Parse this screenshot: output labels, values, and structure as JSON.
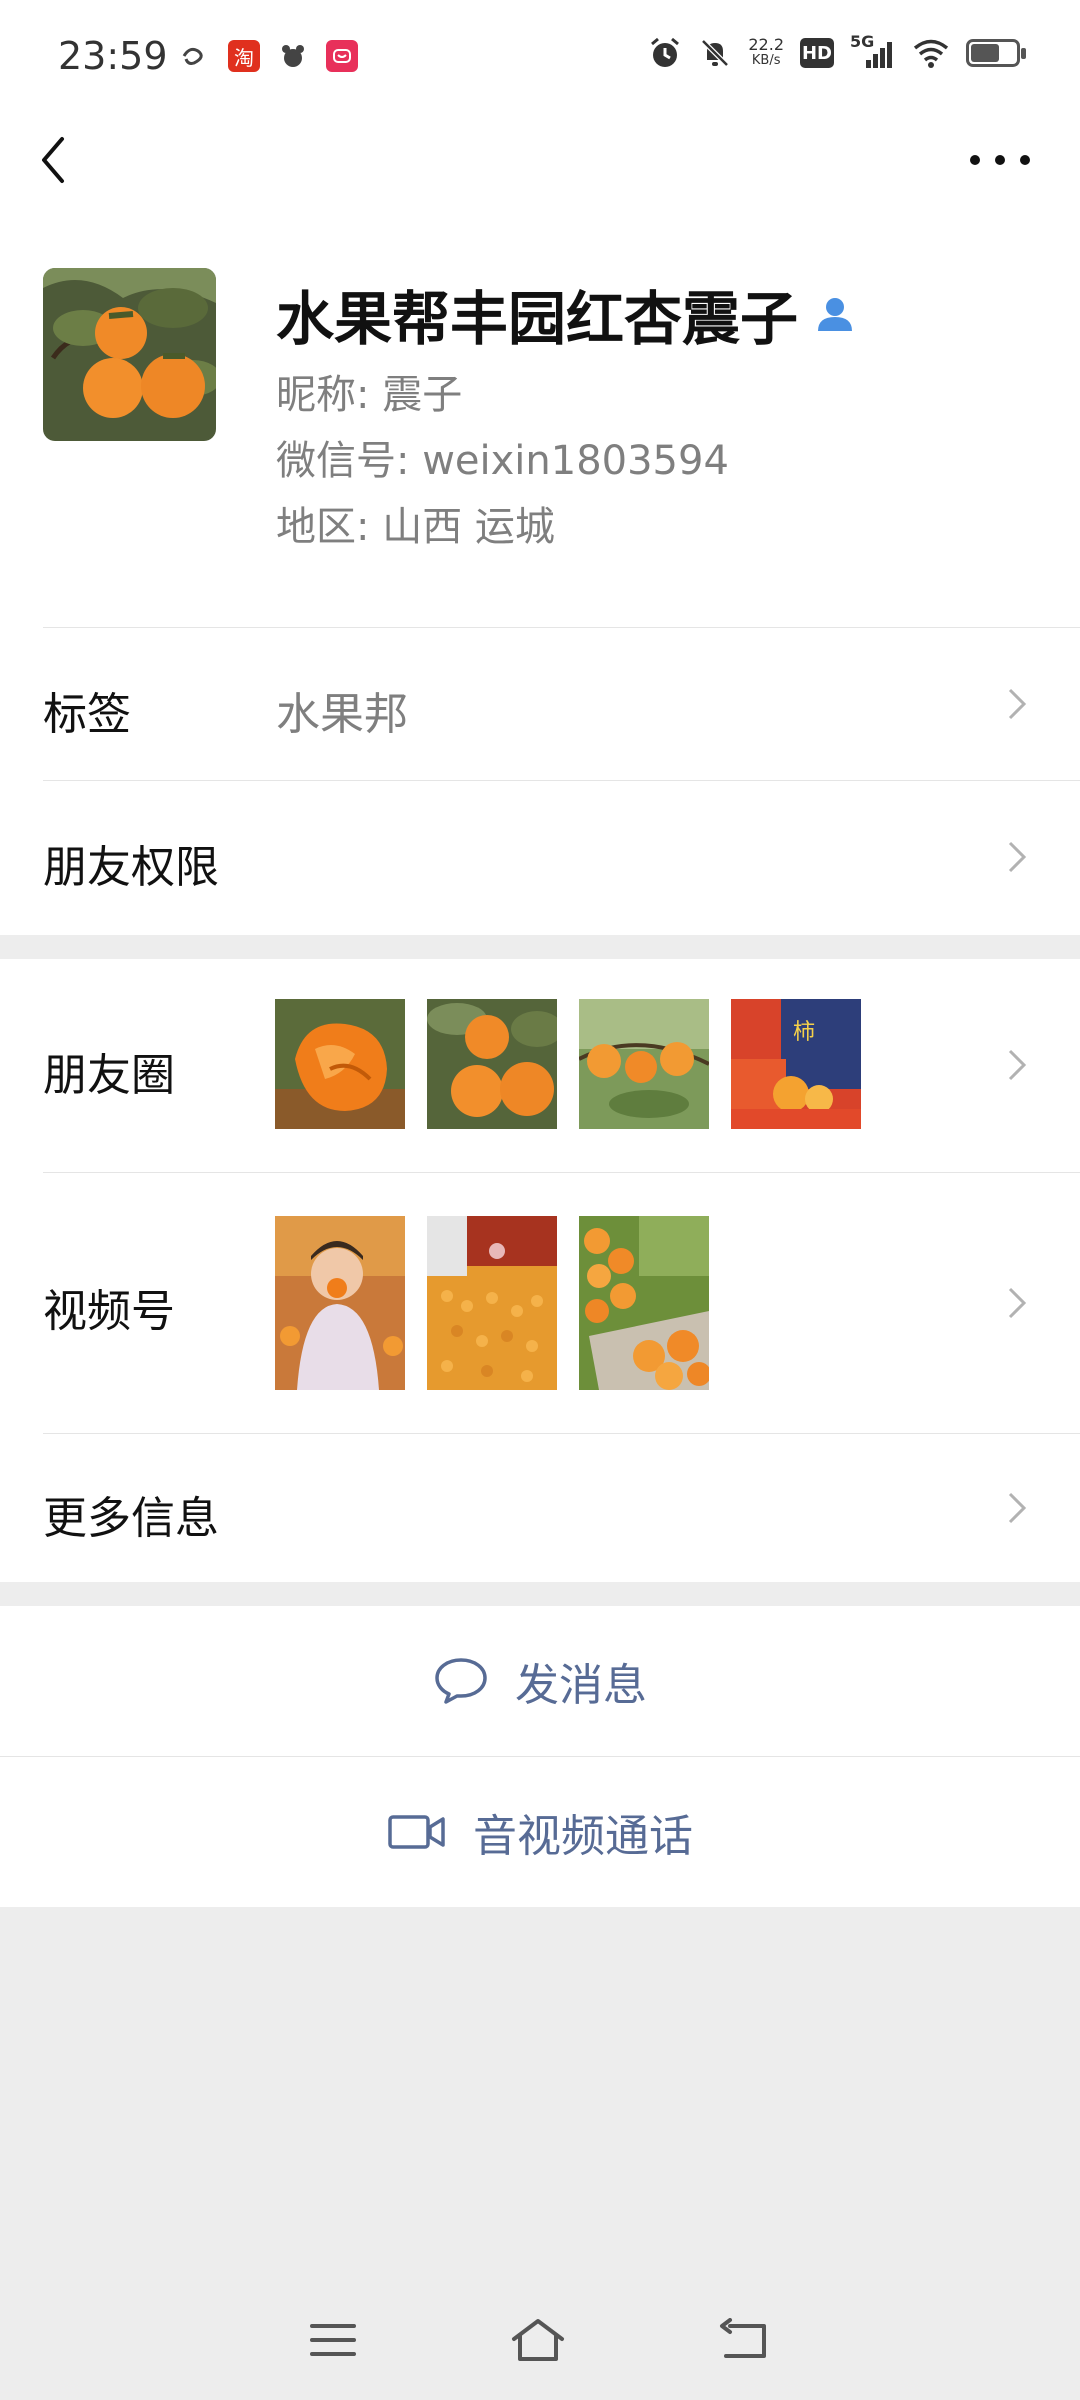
{
  "status_bar": {
    "time": "23:59",
    "net_speed_value": "22.2",
    "net_speed_unit": "KB/s",
    "hd_label": "HD",
    "network_label": "5G"
  },
  "profile": {
    "name": "水果帮丰园红杏震子",
    "nickname": "昵称: 震子",
    "wechat_id": "微信号: weixin1803594",
    "region": "地区: 山西  运城"
  },
  "rows": {
    "tags_label": "标签",
    "tags_value": "水果邦",
    "friend_perm_label": "朋友权限",
    "moments_label": "朋友圈",
    "channels_label": "视频号",
    "more_info_label": "更多信息"
  },
  "actions": {
    "message_label": "发消息",
    "call_label": "音视频通话"
  },
  "colors": {
    "link_blue": "#576b95",
    "background_gray": "#ededed",
    "verified_blue": "#4a90e2"
  }
}
